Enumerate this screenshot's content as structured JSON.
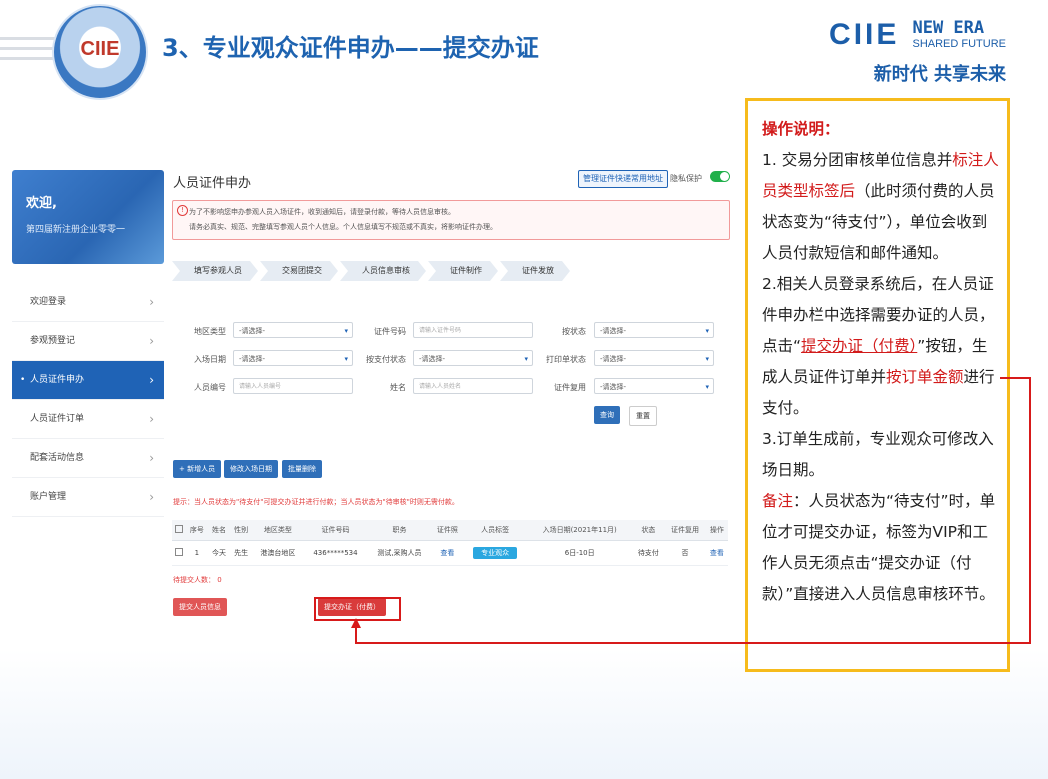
{
  "slide": {
    "logo_text": "CIIE",
    "title": "3、专业观众证件申办——提交办证",
    "brand_ciie": "CIIE",
    "brand_new_era": "NEW ERA",
    "brand_shared": "SHARED FUTURE",
    "brand_cn": "新时代 共享未来"
  },
  "sidebar": {
    "welcome": "欢迎,",
    "company": "第四届新注册企业零零一",
    "items": [
      {
        "label": "欢迎登录"
      },
      {
        "label": "参观预登记"
      },
      {
        "label": "人员证件申办",
        "active": true
      },
      {
        "label": "人员证件订单"
      },
      {
        "label": "配套活动信息"
      },
      {
        "label": "账户管理"
      }
    ]
  },
  "main": {
    "title": "人员证件申办",
    "manage_btn": "管理证件快递常用地址",
    "privacy": "隐私保护",
    "notice_line1": "为了不影响您申办参观人员入场证件，收到通知后，请登录付款，等待人员信息审核。",
    "notice_line2": "请务必真实、规范、完整填写参观人员个人信息。个人信息填写不规范或不真实，将影响证件办理。",
    "steps": [
      "填写参观人员",
      "交易团提交",
      "人员信息审核",
      "证件制作",
      "证件发放"
    ],
    "filters": {
      "region_label": "地区类型",
      "region_value": "-请选择-",
      "certno_label": "证件号码",
      "certno_placeholder": "请输入证件号码",
      "status_label": "按状态",
      "status_value": "-请选择-",
      "entry_label": "入场日期",
      "entry_value": "-请选择-",
      "pay_label": "按支付状态",
      "pay_value": "-请选择-",
      "print_label": "打印单状态",
      "print_value": "-请选择-",
      "pid_label": "人员编号",
      "pid_placeholder": "请输入人员编号",
      "name_label": "姓名",
      "name_placeholder": "请输入人员姓名",
      "reuse_label": "证件复用",
      "reuse_value": "-请选择-",
      "query_btn": "查询",
      "reset_btn": "重置"
    },
    "actions": {
      "add": "+ 新增人员",
      "change_date": "修改入场日期",
      "batch_delete": "批量删除"
    },
    "tip": "提示：当人员状态为\"待支付\"可提交办证并进行付款；当人员状态为\"待审核\"时则无需付款。",
    "table": {
      "headers": [
        "",
        "序号",
        "姓名",
        "性别",
        "地区类型",
        "证件号码",
        "职务",
        "证件照",
        "人员标签",
        "入场日期(2021年11月)",
        "状态",
        "证件复用",
        "操作"
      ],
      "rows": [
        {
          "no": "1",
          "name": "今天",
          "gender": "先生",
          "region": "港澳台地区",
          "cert": "436*****534",
          "job": "测试,采购人员",
          "photo": "查看",
          "tag": "专业观众",
          "date": "6日-10日",
          "status": "待支付",
          "reuse": "否",
          "op": "查看"
        }
      ]
    },
    "pending": "待提交人数：  0",
    "submit_info_btn": "提交人员信息",
    "submit_pay_btn": "提交办证（付费）"
  },
  "note": {
    "heading": "操作说明：",
    "p1_a": "1. 交易分团审核单位信息并",
    "p1_red": "标注人员类型标签后",
    "p1_b": "（此时须付费的人员状态变为“待支付”），单位会收到人员付款短信和邮件通知。",
    "p2_a": "2.相关人员登录系统后，在人员证件申办栏中选择需要办证的人员，点击“",
    "p2_red": "提交办证（付费）",
    "p2_b": "”按钮，生成人员证件订单并",
    "p2_red2": "按订单金额",
    "p2_c": "进行支付。",
    "p3": "3.订单生成前，专业观众可修改入场日期。",
    "p4_red": "备注",
    "p4": "：人员状态为“待支付”时，单位才可提交办证，标签为VIP和工作人员无须点击“提交办证（付款）”直接进入人员信息审核环节。"
  }
}
